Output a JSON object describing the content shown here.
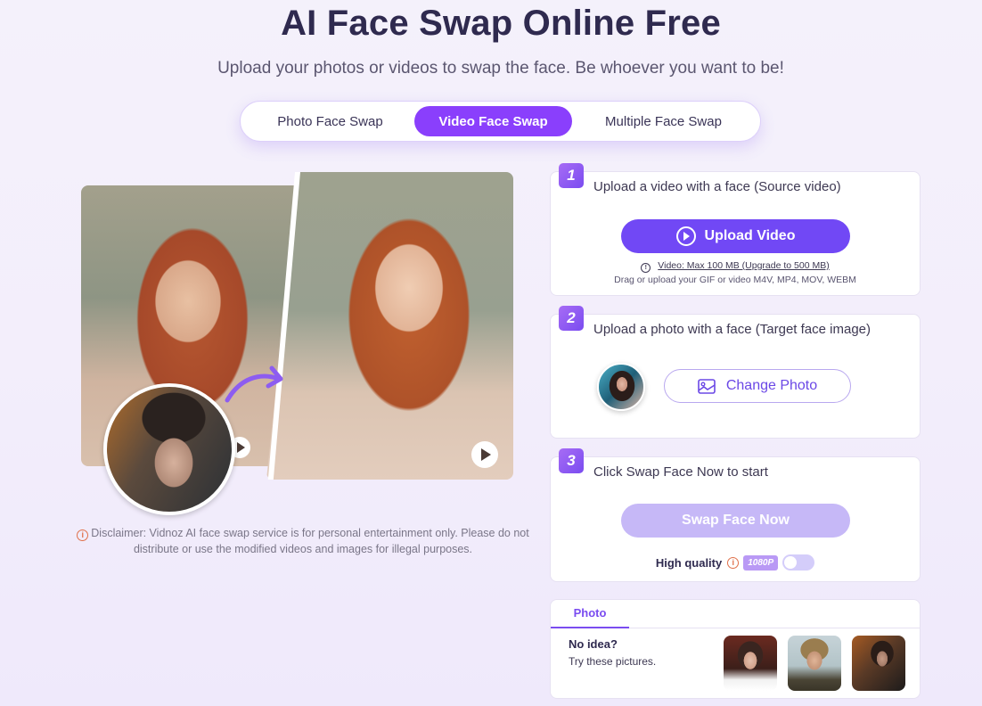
{
  "header": {
    "title": "AI Face Swap Online Free",
    "subtitle": "Upload your photos or videos to swap the face. Be whoever you want to be!"
  },
  "tabs": [
    {
      "label": "Photo Face Swap",
      "active": false
    },
    {
      "label": "Video Face Swap",
      "active": true
    },
    {
      "label": "Multiple Face Swap",
      "active": false
    }
  ],
  "showcase": {
    "disclaimer_icon": "info-icon",
    "disclaimer": "Disclaimer: Vidnoz AI face swap service is for personal entertainment only. Please do not distribute or use the modified videos and images for illegal purposes."
  },
  "steps": {
    "step1": {
      "number": "1",
      "label": "Upload a video with a face (Source video)",
      "button": "Upload Video",
      "limit_icon": "!",
      "limit": "Video: Max 100 MB (Upgrade to 500 MB)",
      "formats": "Drag or upload your GIF or video M4V, MP4, MOV, WEBM"
    },
    "step2": {
      "number": "2",
      "label": "Upload a photo with a face (Target face image)",
      "button": "Change Photo"
    },
    "step3": {
      "number": "3",
      "label": "Click Swap Face Now to start",
      "button": "Swap Face Now",
      "quality_label": "High quality",
      "quality_info": "i",
      "quality_badge": "1080P",
      "quality_enabled": false
    }
  },
  "samples": {
    "tab": "Photo",
    "heading": "No idea?",
    "subtext": "Try these pictures."
  },
  "colors": {
    "accent": "#8a3ffc",
    "primary_button": "#7148f5",
    "disabled_button": "#c6b8f7",
    "title": "#2f2a4f",
    "warning": "#e0704a"
  }
}
